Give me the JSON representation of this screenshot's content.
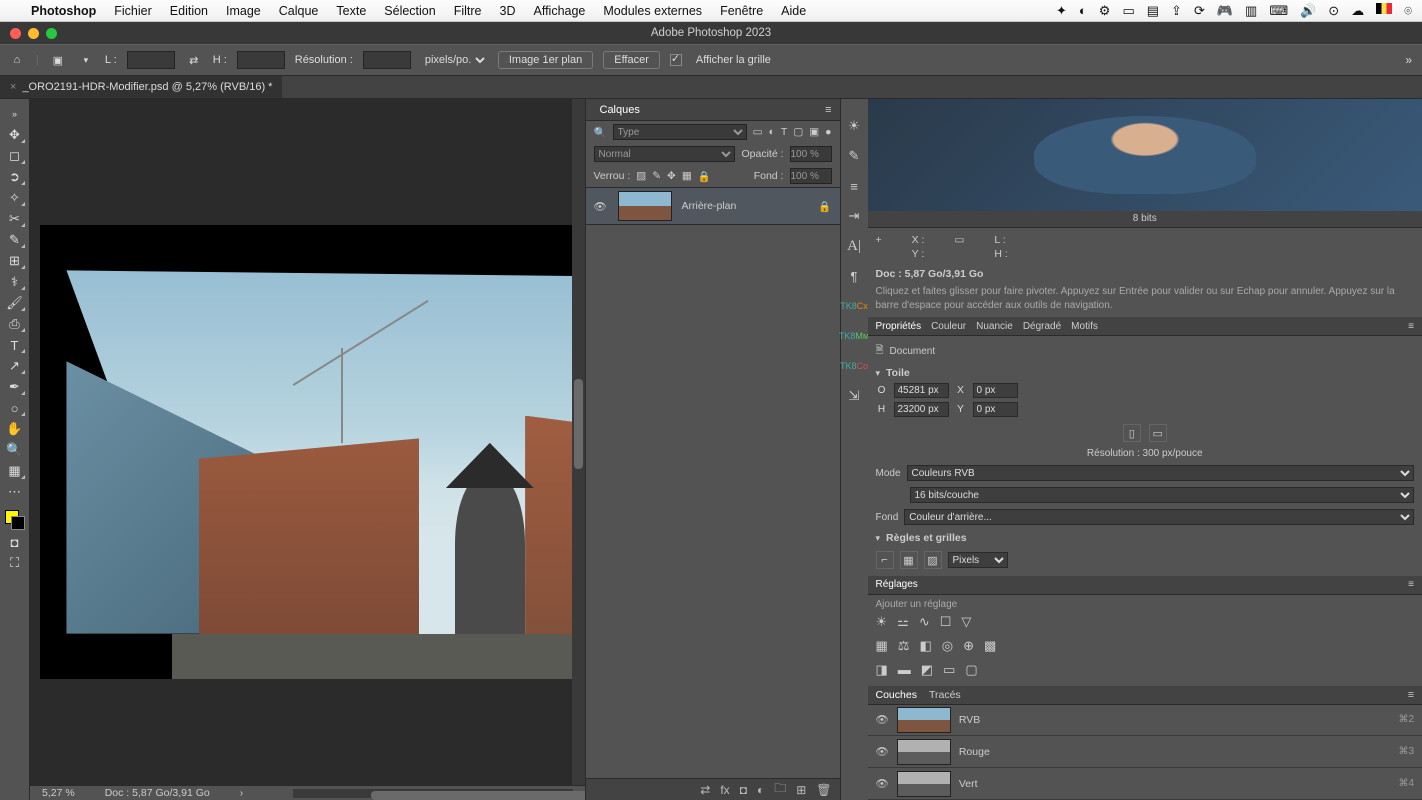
{
  "menubar": {
    "app": "Photoshop",
    "items": [
      "Fichier",
      "Edition",
      "Image",
      "Calque",
      "Texte",
      "Sélection",
      "Filtre",
      "3D",
      "Affichage",
      "Modules externes",
      "Fenêtre",
      "Aide"
    ]
  },
  "window_title": "Adobe Photoshop 2023",
  "options": {
    "L": "L :",
    "H": "H :",
    "resolution_label": "Résolution :",
    "units": "pixels/po.",
    "btn1": "Image 1er plan",
    "btn2": "Effacer",
    "grid": "Afficher la grille"
  },
  "doc_tab": "_ORO2191-HDR-Modifier.psd @ 5,27% (RVB/16) *",
  "status": {
    "zoom": "5,27 %",
    "doc": "Doc : 5,87 Go/3,91 Go"
  },
  "layers_panel": {
    "title": "Calques",
    "kind": "Type",
    "blend": "Normal",
    "opacity_label": "Opacité :",
    "opacity": "100 %",
    "lock": "Verrou :",
    "fill_label": "Fond :",
    "fill": "100 %",
    "layer_name": "Arrière-plan"
  },
  "info": {
    "bits": "8 bits",
    "X": "X :",
    "Y": "Y :",
    "L": "L :",
    "H": "H :",
    "docline": "Doc : 5,87 Go/3,91 Go",
    "hint": "Cliquez et faites glisser pour faire pivoter. Appuyez sur Entrée pour valider ou sur Echap pour annuler. Appuyez sur la barre d'espace pour accéder aux outils de navigation."
  },
  "prop_tabs": [
    "Propriétés",
    "Couleur",
    "Nuancie",
    "Dégradé",
    "Motifs"
  ],
  "prop": {
    "doc": "Document",
    "toile": "Toile",
    "O": "O",
    "W": "45281 px",
    "X": "X",
    "Xv": "0 px",
    "H": "H",
    "Hv": "23200 px",
    "Y": "Y",
    "Yv": "0 px",
    "res": "Résolution : 300 px/pouce",
    "mode": "Mode",
    "mode_v": "Couleurs RVB",
    "depth": "16 bits/couche",
    "fond": "Fond",
    "fond_v": "Couleur d'arrière...",
    "rulers": "Règles et grilles",
    "pixels": "Pixels"
  },
  "reglages": {
    "title": "Réglages",
    "hint": "Ajouter un réglage"
  },
  "channels": {
    "tab1": "Couches",
    "tab2": "Tracés",
    "items": [
      {
        "n": "RVB",
        "k": "⌘2",
        "g": false
      },
      {
        "n": "Rouge",
        "k": "⌘3",
        "g": true
      },
      {
        "n": "Vert",
        "k": "⌘4",
        "g": true
      }
    ]
  }
}
